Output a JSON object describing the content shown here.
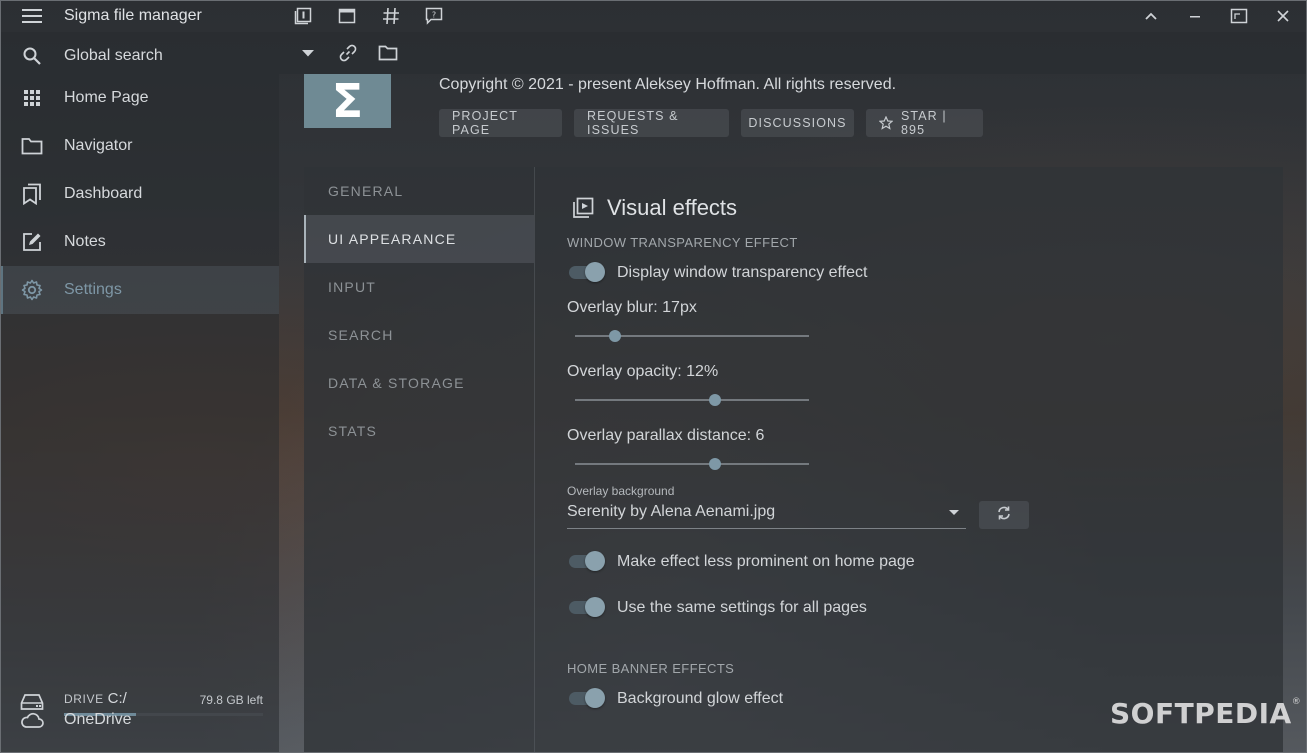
{
  "app": {
    "title": "Sigma file manager"
  },
  "titlebar": {
    "tools": [
      "workspaces-icon",
      "new-window-icon",
      "hashtag-icon",
      "feedback-icon"
    ],
    "window_buttons": [
      "chevron-up-icon",
      "minimize-icon",
      "maximize-icon",
      "close-icon"
    ]
  },
  "sidebar": {
    "items": [
      {
        "label": "Global search",
        "icon": "search-icon"
      },
      {
        "label": "Home Page",
        "icon": "grid-icon"
      },
      {
        "label": "Navigator",
        "icon": "folder-icon"
      },
      {
        "label": "Dashboard",
        "icon": "bookmarks-icon"
      },
      {
        "label": "Notes",
        "icon": "edit-note-icon"
      },
      {
        "label": "Settings",
        "icon": "gear-icon",
        "active": true
      }
    ],
    "drive": {
      "label": "DRIVE",
      "letter": "C:/",
      "free": "79.8 GB left",
      "used_fraction": 0.36
    },
    "cloud": {
      "label": "OneDrive",
      "icon": "cloud-icon"
    }
  },
  "about": {
    "logo_glyph": "Σ",
    "copyright": "Copyright © 2021 - present Aleksey Hoffman. All rights reserved.",
    "buttons": [
      "PROJECT PAGE",
      "REQUESTS & ISSUES",
      "DISCUSSIONS",
      "STAR | 895"
    ]
  },
  "settings": {
    "tabs": [
      {
        "label": "GENERAL"
      },
      {
        "label": "UI APPEARANCE",
        "active": true
      },
      {
        "label": "INPUT"
      },
      {
        "label": "SEARCH"
      },
      {
        "label": "DATA & STORAGE"
      },
      {
        "label": "STATS"
      }
    ],
    "section_title": "Visual effects",
    "window_transparency": {
      "subhead": "WINDOW TRANSPARENCY EFFECT",
      "toggle_label": "Display window transparency effect",
      "toggle_on": true,
      "blur": {
        "label": "Overlay blur: 17px",
        "fraction": 0.17
      },
      "opacity": {
        "label": "Overlay opacity: 12%",
        "fraction": 0.6
      },
      "parallax": {
        "label": "Overlay parallax distance: 6",
        "fraction": 0.6
      },
      "background": {
        "caption": "Overlay background",
        "value": "Serenity by Alena Aenami.jpg"
      },
      "less_prominent": {
        "label": "Make effect less prominent on home page",
        "on": true
      },
      "same_settings": {
        "label": "Use the same settings for all pages",
        "on": true
      }
    },
    "home_banner": {
      "subhead": "HOME BANNER EFFECTS",
      "glow": {
        "label": "Background glow effect",
        "on": true
      }
    }
  },
  "watermark": {
    "text": "SOFTPEDIA",
    "mark": "®"
  }
}
